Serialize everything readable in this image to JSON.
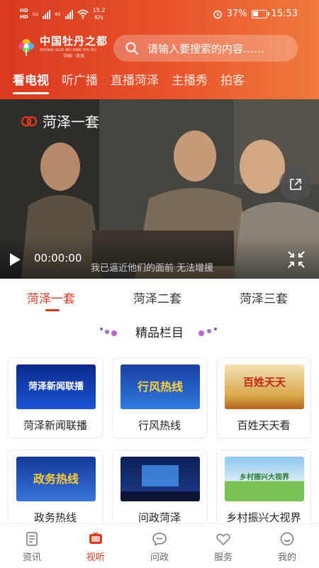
{
  "status_bar": {
    "network_tags": [
      "HD",
      "HD"
    ],
    "signal_5g": "5G",
    "signal_4g": "4G",
    "speed_value": "15.2",
    "speed_unit": "K/s",
    "battery_percent": "37%",
    "battery_level": 0.37,
    "time": "15:53"
  },
  "header": {
    "logo_text": "中国牡丹之都",
    "logo_pinyin": "ZHONG GUO MU DAN ZHI DU",
    "logo_sub": "中国 · 菏泽",
    "search_placeholder": "请输入要搜索的内容……",
    "tabs": [
      {
        "label": "看电视",
        "active": true
      },
      {
        "label": "听广播",
        "active": false
      },
      {
        "label": "直播菏泽",
        "active": false
      },
      {
        "label": "主播秀",
        "active": false
      },
      {
        "label": "拍客",
        "active": false
      }
    ]
  },
  "player": {
    "channel_name": "菏泽一套",
    "time": "00:00:00",
    "subtitle": "我已逼近他们的面前 无法增援",
    "icons": [
      "play-icon",
      "share-icon",
      "fullscreen-icon"
    ]
  },
  "channels": [
    {
      "label": "菏泽一套",
      "active": true
    },
    {
      "label": "菏泽二套",
      "active": false
    },
    {
      "label": "菏泽三套",
      "active": false
    }
  ],
  "section_title": "精品栏目",
  "programs": [
    {
      "label": "菏泽新闻联播",
      "thumb_text": "菏泽新闻联播"
    },
    {
      "label": "行风热线",
      "thumb_text": "行风热线"
    },
    {
      "label": "百姓天天看",
      "thumb_text": "百姓天天"
    },
    {
      "label": "政务热线",
      "thumb_text": "政务热线"
    },
    {
      "label": "问政菏泽",
      "thumb_text": ""
    },
    {
      "label": "乡村振兴大视界",
      "thumb_text": "乡村振兴大视界"
    }
  ],
  "bottom_nav": [
    {
      "label": "资讯",
      "icon": "news-icon",
      "active": false
    },
    {
      "label": "视听",
      "icon": "tv-icon",
      "active": true
    },
    {
      "label": "问政",
      "icon": "chat-icon",
      "active": false
    },
    {
      "label": "服务",
      "icon": "heart-icon",
      "active": false
    },
    {
      "label": "我的",
      "icon": "smile-icon",
      "active": false
    }
  ],
  "colors": {
    "accent": "#d9391f",
    "header_gradient_start": "#d9391f",
    "header_gradient_end": "#f07a3c"
  }
}
